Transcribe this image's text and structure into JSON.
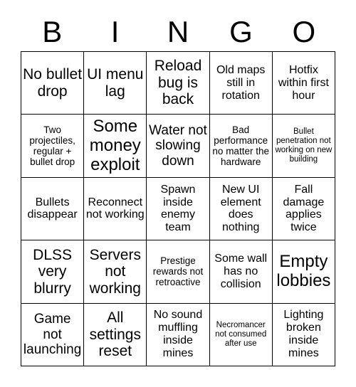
{
  "card": {
    "title_letters": [
      "B",
      "I",
      "N",
      "G",
      "O"
    ],
    "colors": {
      "background": "#ffffff",
      "text": "#000000",
      "grid_line": "#000000"
    },
    "grid": {
      "rows": 5,
      "columns": 5
    }
  },
  "cells": [
    {
      "text": "No bullet drop",
      "row": 1,
      "col": 1,
      "size": "fs-xl"
    },
    {
      "text": "UI menu lag",
      "row": 1,
      "col": 2,
      "size": "fs-xl"
    },
    {
      "text": "Reload bug is back",
      "row": 1,
      "col": 3,
      "size": "fs-xl"
    },
    {
      "text": "Old maps still in rotation",
      "row": 1,
      "col": 4,
      "size": "fs-md"
    },
    {
      "text": "Hotfix within first hour",
      "row": 1,
      "col": 5,
      "size": "fs-md"
    },
    {
      "text": "Two projectiles, regular + bullet drop",
      "row": 2,
      "col": 1,
      "size": "fs-sm"
    },
    {
      "text": "Some money exploit",
      "row": 2,
      "col": 2,
      "size": "fs-xxl"
    },
    {
      "text": "Water not slowing down",
      "row": 2,
      "col": 3,
      "size": "fs-lg"
    },
    {
      "text": "Bad performance no matter the hardware",
      "row": 2,
      "col": 4,
      "size": "fs-sm"
    },
    {
      "text": "Bullet penetration not working on new building",
      "row": 2,
      "col": 5,
      "size": "fs-xs"
    },
    {
      "text": "Bullets disappear",
      "row": 3,
      "col": 1,
      "size": "fs-md"
    },
    {
      "text": "Reconnect not working",
      "row": 3,
      "col": 2,
      "size": "fs-md"
    },
    {
      "text": "Spawn inside enemy team",
      "row": 3,
      "col": 3,
      "size": "fs-md"
    },
    {
      "text": "New UI element does nothing",
      "row": 3,
      "col": 4,
      "size": "fs-md"
    },
    {
      "text": "Fall damage applies twice",
      "row": 3,
      "col": 5,
      "size": "fs-md"
    },
    {
      "text": "DLSS very blurry",
      "row": 4,
      "col": 1,
      "size": "fs-xl"
    },
    {
      "text": "Servers not working",
      "row": 4,
      "col": 2,
      "size": "fs-xl"
    },
    {
      "text": "Prestige rewards not retroactive",
      "row": 4,
      "col": 3,
      "size": "fs-sm"
    },
    {
      "text": "Some wall has no collision",
      "row": 4,
      "col": 4,
      "size": "fs-md"
    },
    {
      "text": "Empty lobbies",
      "row": 4,
      "col": 5,
      "size": "fs-xxl"
    },
    {
      "text": "Game not launching",
      "row": 5,
      "col": 1,
      "size": "fs-lg"
    },
    {
      "text": "All settings reset",
      "row": 5,
      "col": 2,
      "size": "fs-xl"
    },
    {
      "text": "No sound muffling inside mines",
      "row": 5,
      "col": 3,
      "size": "fs-md"
    },
    {
      "text": "Necromancer not consumed after use",
      "row": 5,
      "col": 4,
      "size": "fs-xs"
    },
    {
      "text": "Lighting broken inside mines",
      "row": 5,
      "col": 5,
      "size": "fs-md"
    }
  ]
}
